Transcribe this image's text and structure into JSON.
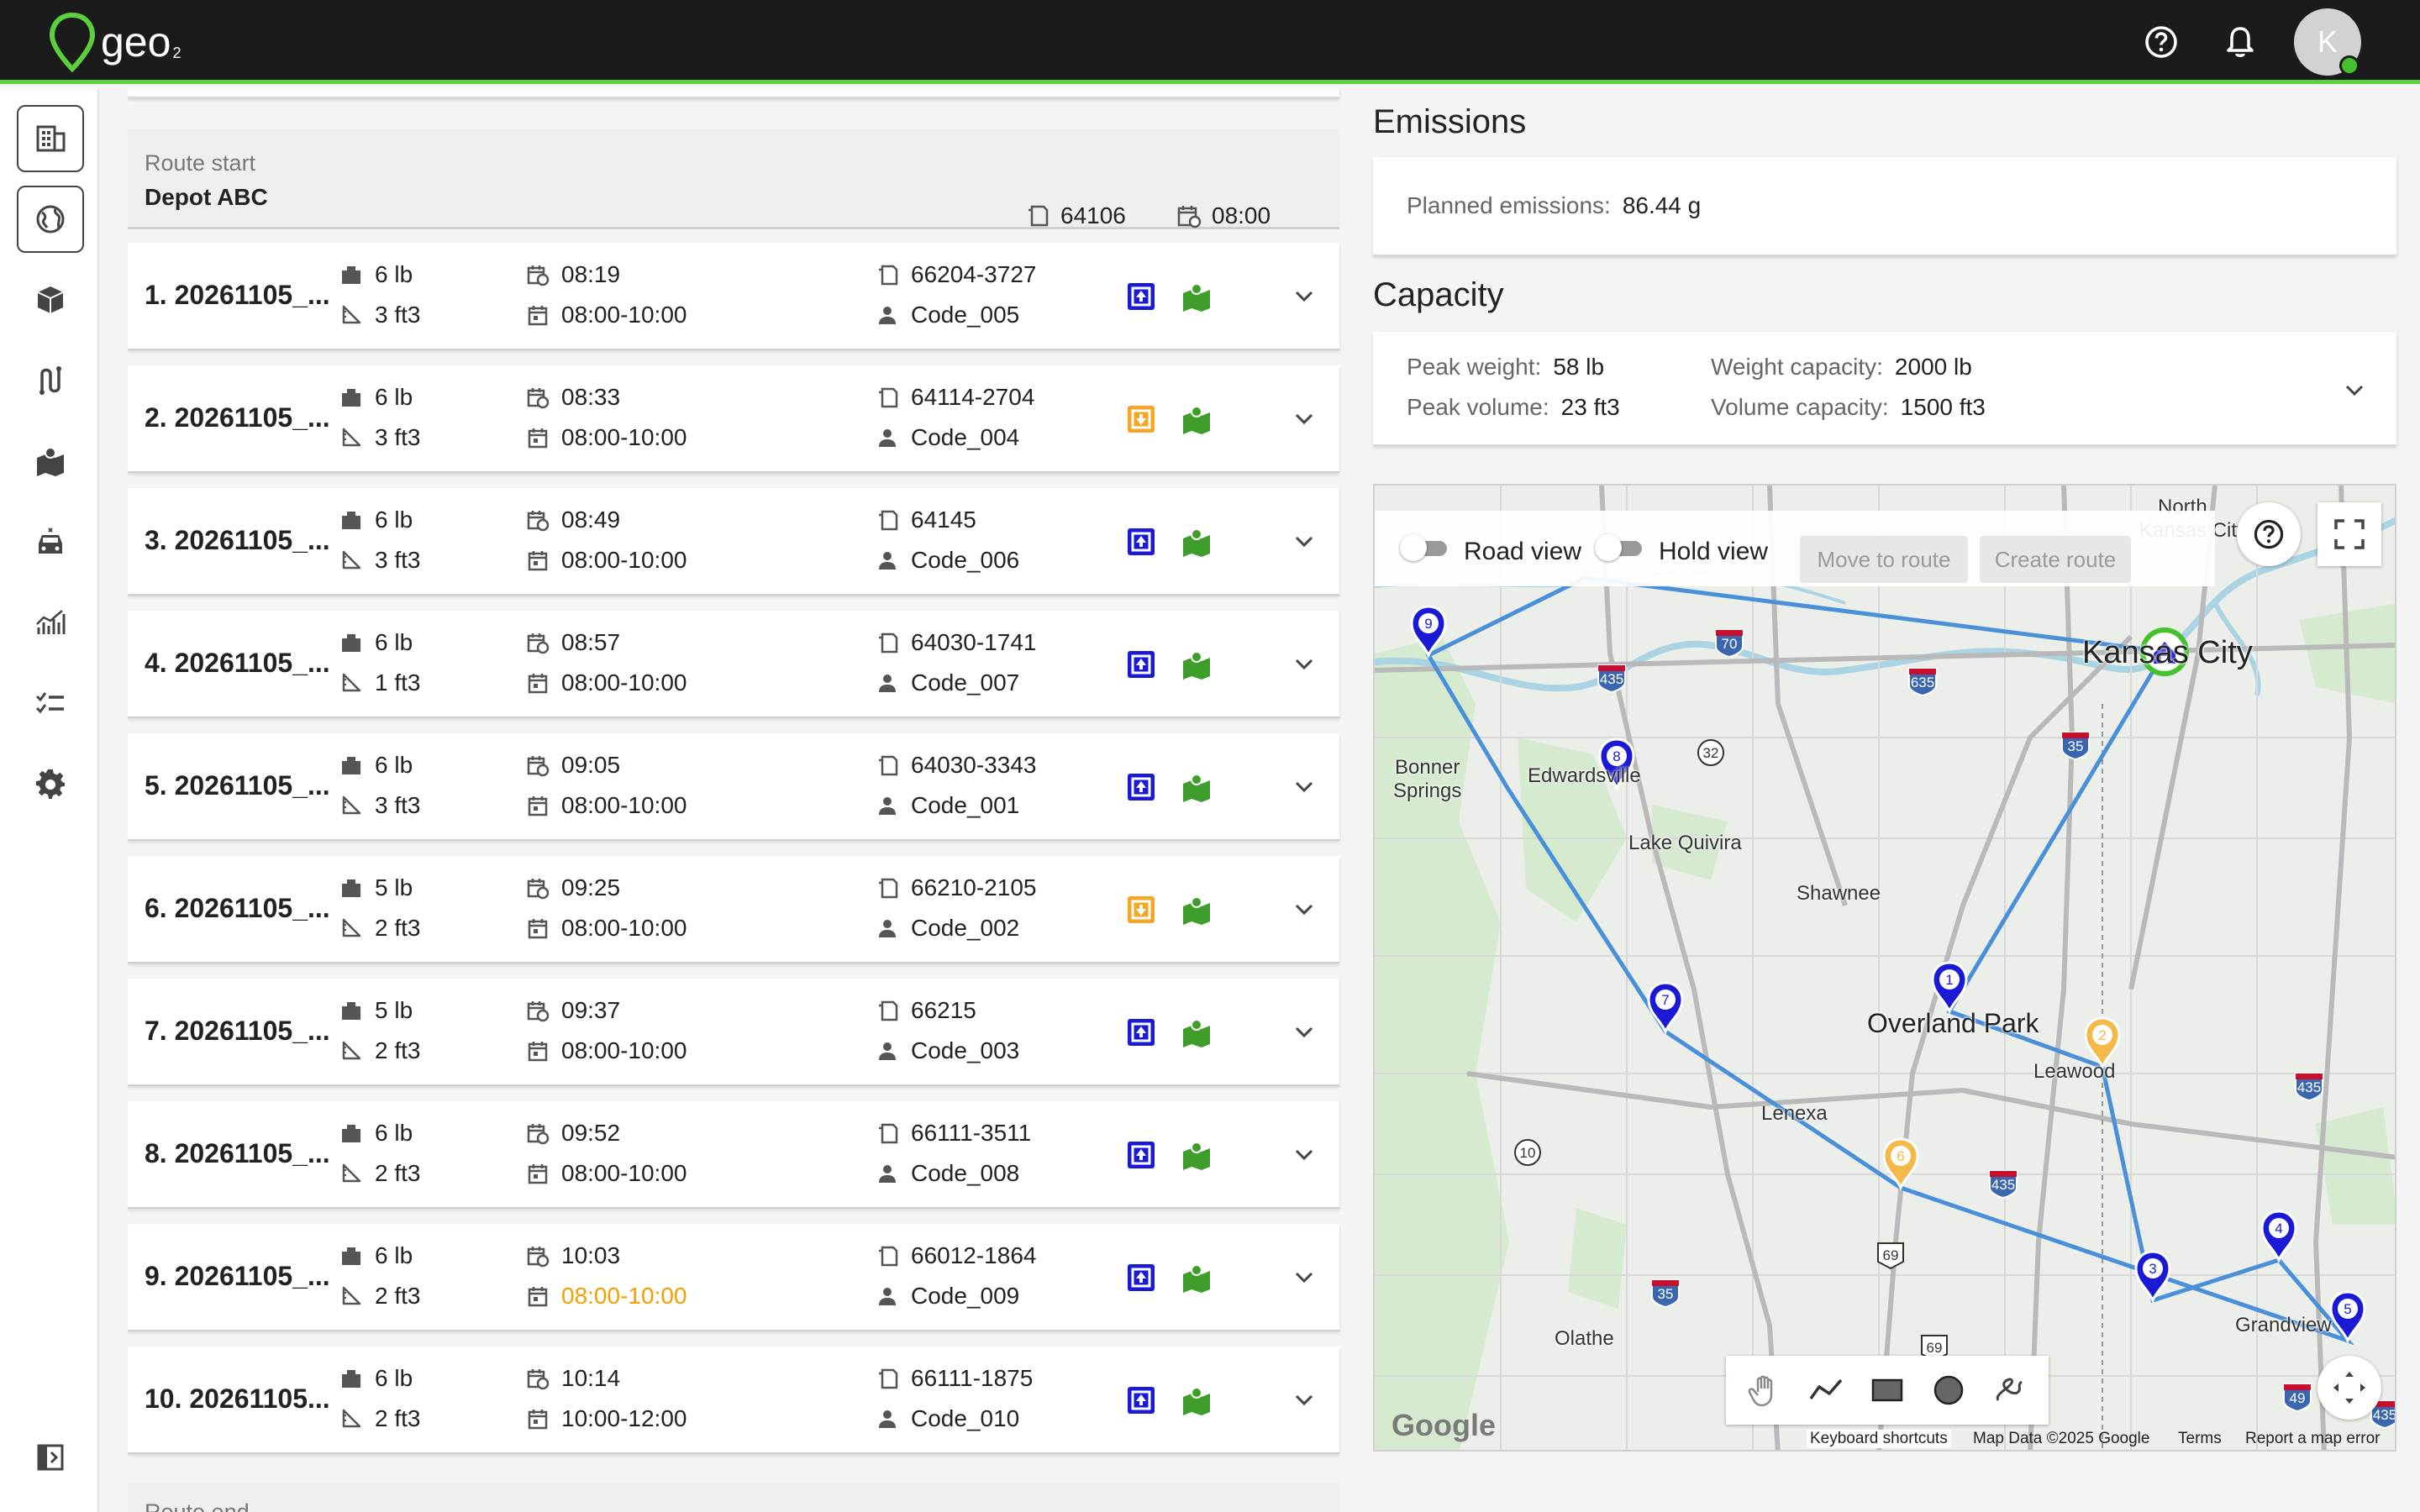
{
  "app": {
    "logo_text": "geo",
    "logo_sub": "2",
    "avatar_initial": "K"
  },
  "route_start": {
    "label": "Route start",
    "name": "Depot ABC",
    "postal": "64106",
    "time": "08:00"
  },
  "route_end": {
    "label": "Route end"
  },
  "stops": [
    {
      "title": "1. 20261105_...",
      "weight": "6 lb",
      "volume": "3 ft3",
      "eta": "08:19",
      "window": "08:00-10:00",
      "window_late": false,
      "postal": "66204-3727",
      "code": "Code_005",
      "type": "delivery"
    },
    {
      "title": "2. 20261105_...",
      "weight": "6 lb",
      "volume": "3 ft3",
      "eta": "08:33",
      "window": "08:00-10:00",
      "window_late": false,
      "postal": "64114-2704",
      "code": "Code_004",
      "type": "pickup"
    },
    {
      "title": "3. 20261105_...",
      "weight": "6 lb",
      "volume": "3 ft3",
      "eta": "08:49",
      "window": "08:00-10:00",
      "window_late": false,
      "postal": "64145",
      "code": "Code_006",
      "type": "delivery"
    },
    {
      "title": "4. 20261105_...",
      "weight": "6 lb",
      "volume": "1 ft3",
      "eta": "08:57",
      "window": "08:00-10:00",
      "window_late": false,
      "postal": "64030-1741",
      "code": "Code_007",
      "type": "delivery"
    },
    {
      "title": "5. 20261105_...",
      "weight": "6 lb",
      "volume": "3 ft3",
      "eta": "09:05",
      "window": "08:00-10:00",
      "window_late": false,
      "postal": "64030-3343",
      "code": "Code_001",
      "type": "delivery"
    },
    {
      "title": "6. 20261105_...",
      "weight": "5 lb",
      "volume": "2 ft3",
      "eta": "09:25",
      "window": "08:00-10:00",
      "window_late": false,
      "postal": "66210-2105",
      "code": "Code_002",
      "type": "pickup"
    },
    {
      "title": "7. 20261105_...",
      "weight": "5 lb",
      "volume": "2 ft3",
      "eta": "09:37",
      "window": "08:00-10:00",
      "window_late": false,
      "postal": "66215",
      "code": "Code_003",
      "type": "delivery"
    },
    {
      "title": "8. 20261105_...",
      "weight": "6 lb",
      "volume": "2 ft3",
      "eta": "09:52",
      "window": "08:00-10:00",
      "window_late": false,
      "postal": "66111-3511",
      "code": "Code_008",
      "type": "delivery"
    },
    {
      "title": "9. 20261105_...",
      "weight": "6 lb",
      "volume": "2 ft3",
      "eta": "10:03",
      "window": "08:00-10:00",
      "window_late": true,
      "postal": "66012-1864",
      "code": "Code_009",
      "type": "delivery"
    },
    {
      "title": "10. 20261105...",
      "weight": "6 lb",
      "volume": "2 ft3",
      "eta": "10:14",
      "window": "10:00-12:00",
      "window_late": false,
      "postal": "66111-1875",
      "code": "Code_010",
      "type": "delivery"
    }
  ],
  "emissions": {
    "title": "Emissions",
    "label": "Planned emissions:",
    "value": "86.44 g"
  },
  "capacity": {
    "title": "Capacity",
    "peak_weight_label": "Peak weight:",
    "peak_weight": "58 lb",
    "peak_volume_label": "Peak volume:",
    "peak_volume": "23 ft3",
    "weight_cap_label": "Weight capacity:",
    "weight_cap": "2000 lb",
    "volume_cap_label": "Volume capacity:",
    "volume_cap": "1500 ft3"
  },
  "map": {
    "road_view": "Road view",
    "hold_view": "Hold view",
    "move_to_route": "Move to route",
    "create_route": "Create route",
    "labels": {
      "north_kc": "North",
      "kansas_city_small": "Kansas City",
      "kansas_city": "Kansas City",
      "bonner": "Bonner",
      "springs": "Springs",
      "edwardsville": "Edwardsville",
      "lake_quivira": "Lake Quivira",
      "shawnee": "Shawnee",
      "overland_park": "Overland Park",
      "leawood": "Leawood",
      "lenexa": "Lenexa",
      "olathe": "Olathe",
      "grandview": "Grandview"
    },
    "shields": [
      "435",
      "70",
      "635",
      "32",
      "35",
      "435",
      "10",
      "435",
      "69",
      "35",
      "69",
      "49",
      "435",
      "435"
    ],
    "google": "Google",
    "attribution": {
      "shortcuts": "Keyboard shortcuts",
      "data": "Map Data ©2025 Google",
      "terms": "Terms",
      "report": "Report a map error"
    },
    "route_color": "#4a90d9",
    "delivery_color": "#1a1ad6",
    "pickup_color": "#f5b94a",
    "depot_color": "#43c22e",
    "markers": [
      {
        "label": "1",
        "type": "delivery"
      },
      {
        "label": "2",
        "type": "pickup"
      },
      {
        "label": "3",
        "type": "delivery"
      },
      {
        "label": "4",
        "type": "delivery"
      },
      {
        "label": "5",
        "type": "delivery"
      },
      {
        "label": "6",
        "type": "pickup"
      },
      {
        "label": "7",
        "type": "delivery"
      },
      {
        "label": "8",
        "type": "delivery"
      },
      {
        "label": "9",
        "type": "delivery"
      }
    ]
  },
  "colors": {
    "accent_green": "#5ccf3c",
    "icon_blue": "#1a1ad6",
    "icon_orange": "#f5a623",
    "icon_green": "#3f9e2b",
    "late_orange": "#f0a000"
  }
}
